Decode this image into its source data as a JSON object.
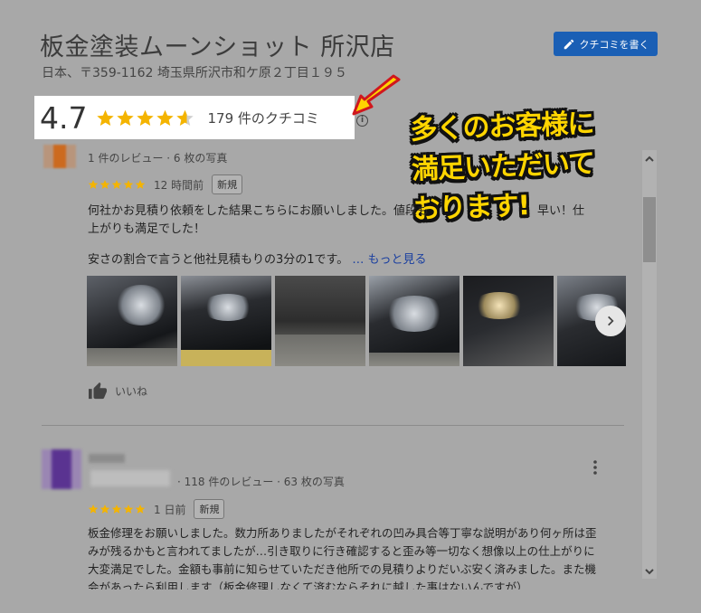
{
  "business": {
    "title": "板金塗装ムーンショット 所沢店",
    "address": "日本、〒359-1162 埼玉県所沢市和ケ原２丁目１９５"
  },
  "header": {
    "write_review_label": "クチコミを書く"
  },
  "rating": {
    "value": "4.7",
    "stars": 4.7,
    "count_label": "179 件のクチコミ",
    "info_icon": "i"
  },
  "callout": {
    "lines": [
      "多くのお客様に",
      "満足いただいて",
      "おります!"
    ]
  },
  "reviews": [
    {
      "meta": "1 件のレビュー · 6 枚の写真",
      "stars": 5,
      "time": "12 時間前",
      "badge": "新規",
      "text_line1": "何社かお見積り依頼をした結果こちらにお願いしました。値段も",
      "text_line1_end": "早い！仕",
      "text_line2": "上がりも満足でした！",
      "text_line3": "安さの割合で言うと他社見積もりの3分の1です。",
      "more": "… もっと見る",
      "photo_count": 6,
      "like_label": "いいね"
    },
    {
      "meta": "· 118 件のレビュー · 63 枚の写真",
      "stars": 5,
      "time": "1 日前",
      "badge": "新規",
      "text_line1": "板金修理をお願いしました。数力所ありましたがそれぞれの凹み具合等丁寧な説明があり何ヶ所は歪",
      "text_line2": "みが残るかもと言われてましたが…引き取りに行き確認すると歪み等一切なく想像以上の仕上がりに",
      "text_line3": "大変満足でした。金額も事前に知らせていただき他所での見積りよりだいぶ安く済みました。また機",
      "text_line4": "会があったら利用します（板金修理しなくて済むならそれに越した事はないんですが）"
    }
  ],
  "colors": {
    "star": "#f4b400",
    "callout_text": "#ffd500",
    "button": "#1a5fb5",
    "link": "#1a3fa0"
  }
}
